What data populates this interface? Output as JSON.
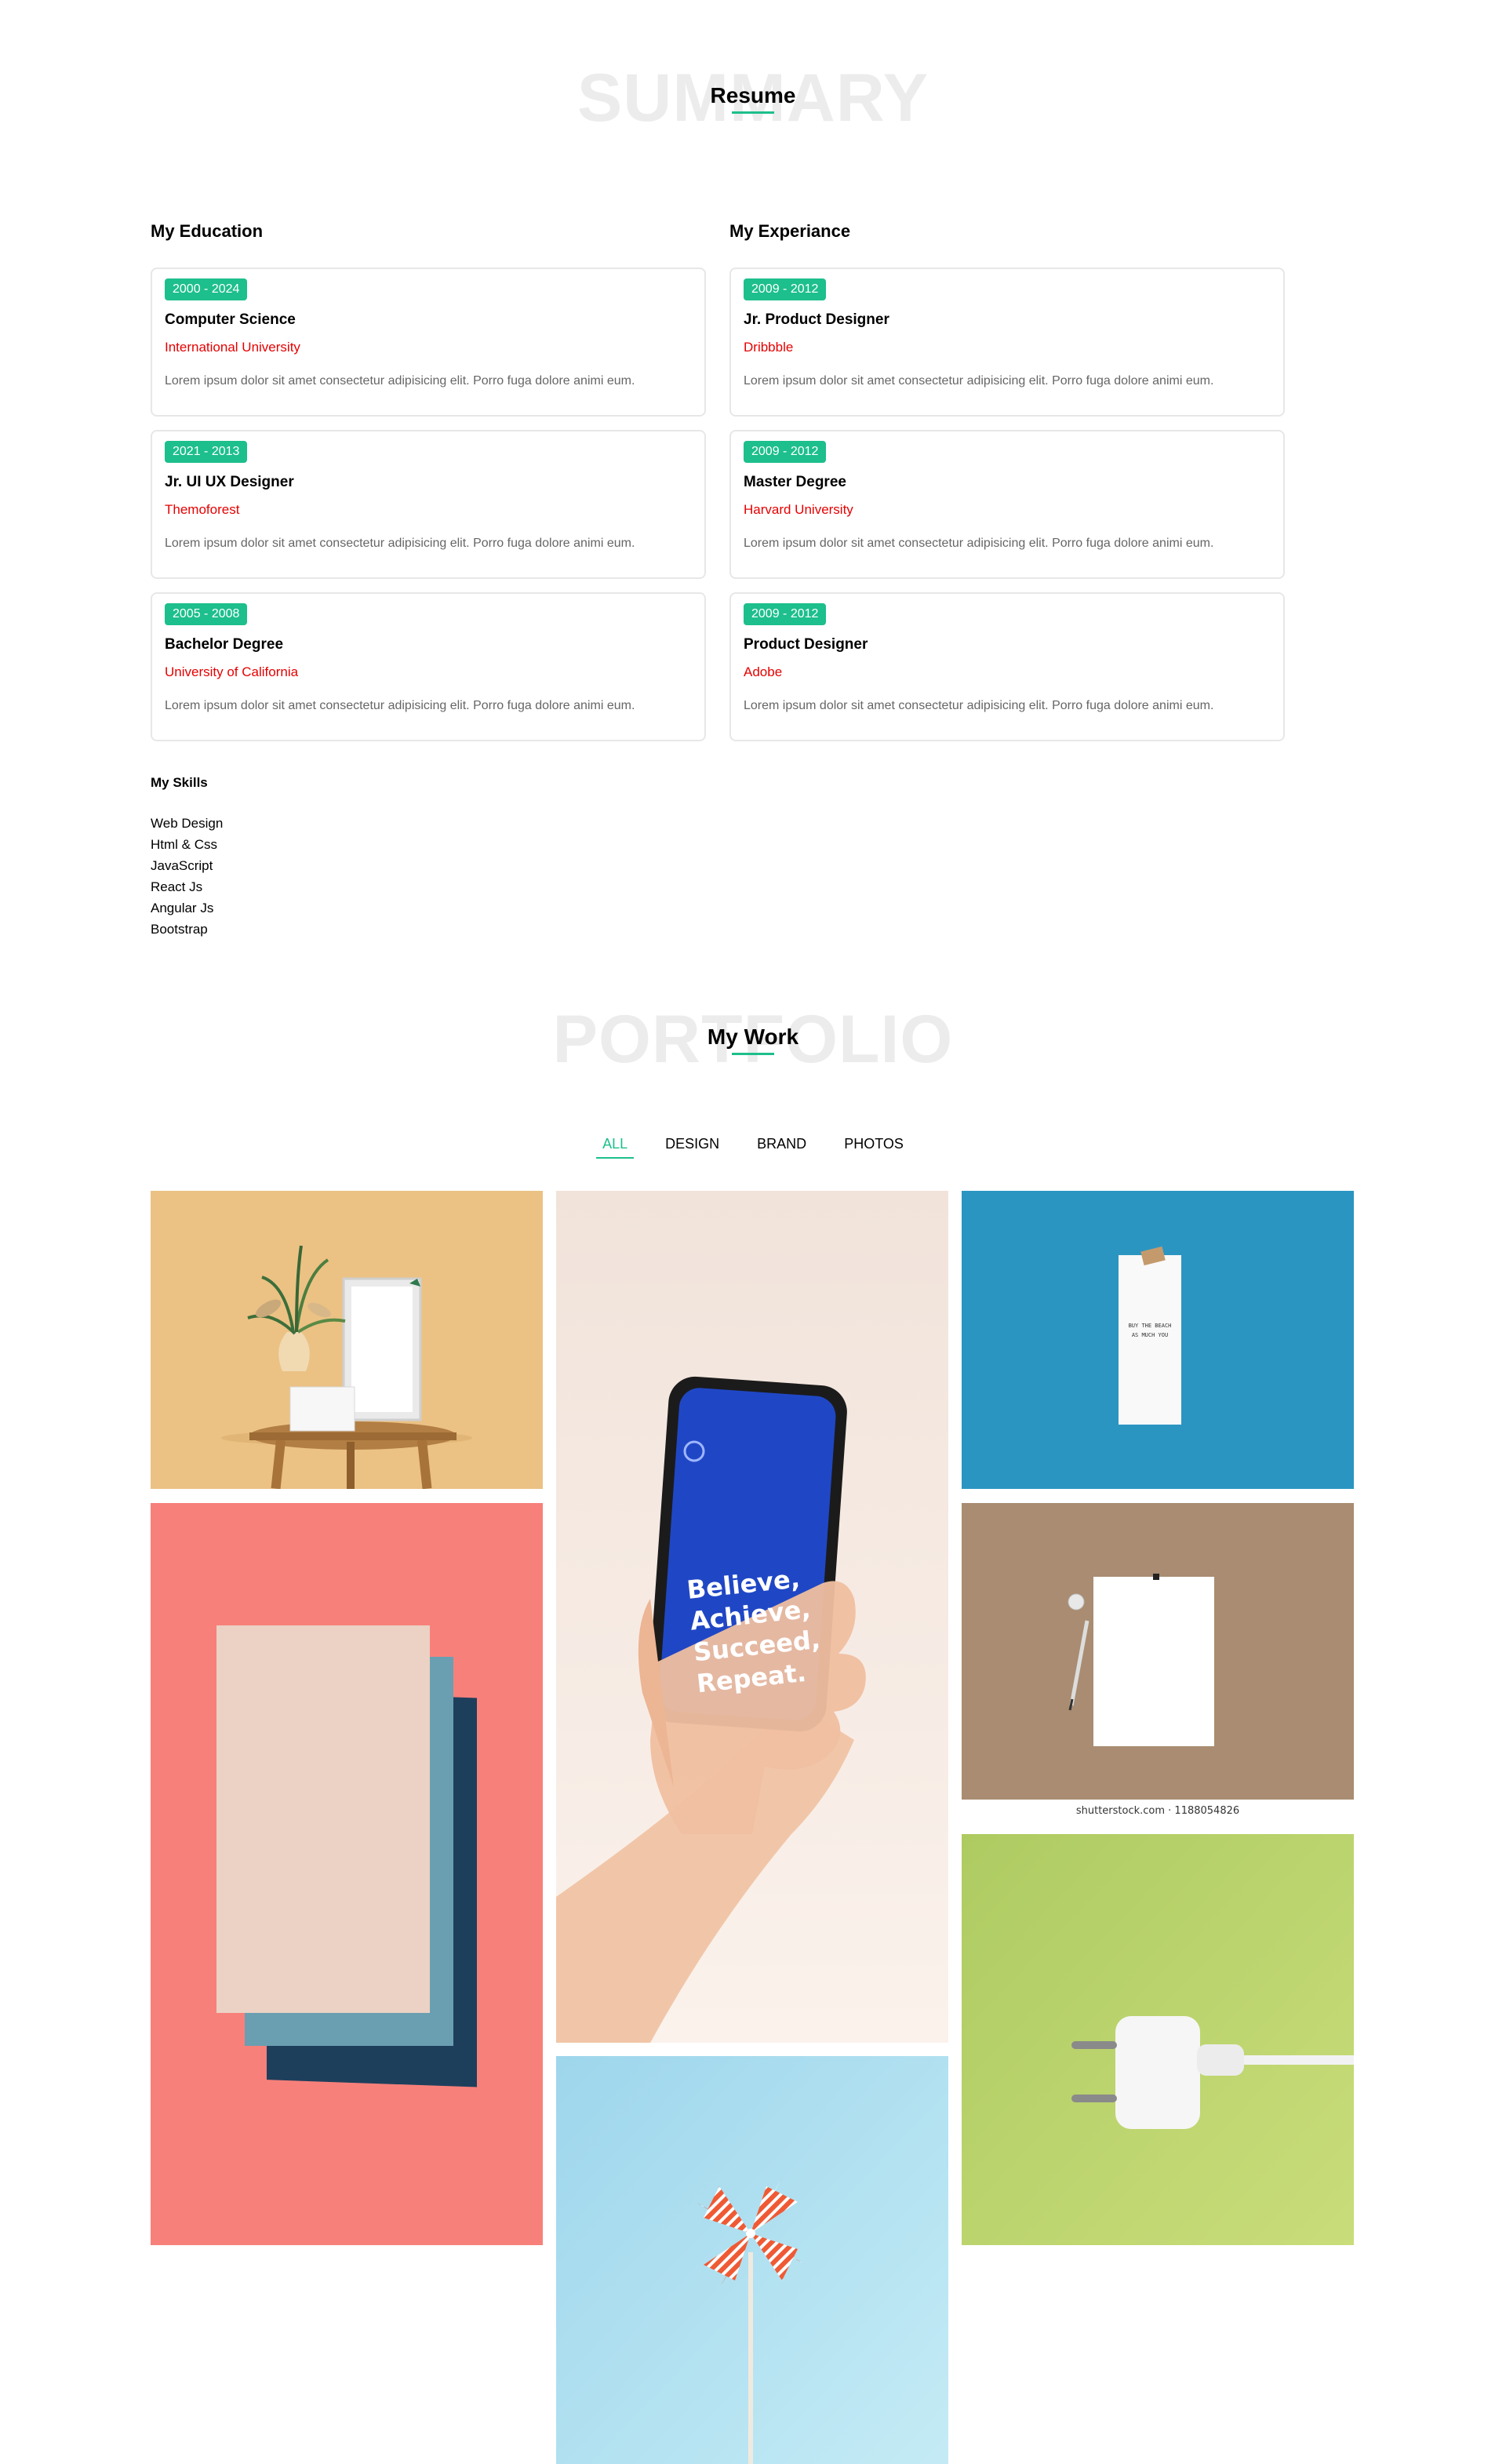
{
  "resume_section": {
    "ghost_title": "SUMMARY",
    "title": "Resume"
  },
  "education": {
    "heading": "My Education",
    "items": [
      {
        "years": "2000 - 2024",
        "title": "Computer Science",
        "org": "International University",
        "desc": "Lorem ipsum dolor sit amet consectetur adipisicing elit. Porro fuga dolore animi eum."
      },
      {
        "years": "2021 - 2013",
        "title": "Jr. UI UX Designer",
        "org": "Themoforest",
        "desc": "Lorem ipsum dolor sit amet consectetur adipisicing elit. Porro fuga dolore animi eum."
      },
      {
        "years": "2005 - 2008",
        "title": "Bachelor Degree",
        "org": "University of California",
        "desc": "Lorem ipsum dolor sit amet consectetur adipisicing elit. Porro fuga dolore animi eum."
      }
    ]
  },
  "experience": {
    "heading": "My Experiance",
    "items": [
      {
        "years": "2009 - 2012",
        "title": "Jr. Product Designer",
        "org": "Dribbble",
        "desc": "Lorem ipsum dolor sit amet consectetur adipisicing elit. Porro fuga dolore animi eum."
      },
      {
        "years": "2009 - 2012",
        "title": "Master Degree",
        "org": "Harvard University",
        "desc": "Lorem ipsum dolor sit amet consectetur adipisicing elit. Porro fuga dolore animi eum."
      },
      {
        "years": "2009 - 2012",
        "title": "Product Designer",
        "org": "Adobe",
        "desc": "Lorem ipsum dolor sit amet consectetur adipisicing elit. Porro fuga dolore animi eum."
      }
    ]
  },
  "skills": {
    "heading": "My Skills",
    "items": [
      "Web Design",
      "Html & Css",
      "JavaScript",
      "React Js",
      "Angular Js",
      "Bootstrap"
    ]
  },
  "portfolio_section": {
    "ghost_title": "PORTFOLIO",
    "title": "My Work",
    "filters": [
      "ALL",
      "DESIGN",
      "BRAND",
      "PHOTOS"
    ],
    "active_filter": "ALL"
  },
  "gallery": {
    "phone_text": [
      "Believe,",
      "Achieve,",
      "Succeed,",
      "Repeat."
    ],
    "watermark": "shutterstock.com · 1188054826",
    "note_text": [
      "BUY THE BEACH",
      "AS MUCH YOU"
    ]
  },
  "colors": {
    "accent": "#1dbf8c",
    "org_red": "#e60000",
    "ghost_gray": "#ececec"
  }
}
